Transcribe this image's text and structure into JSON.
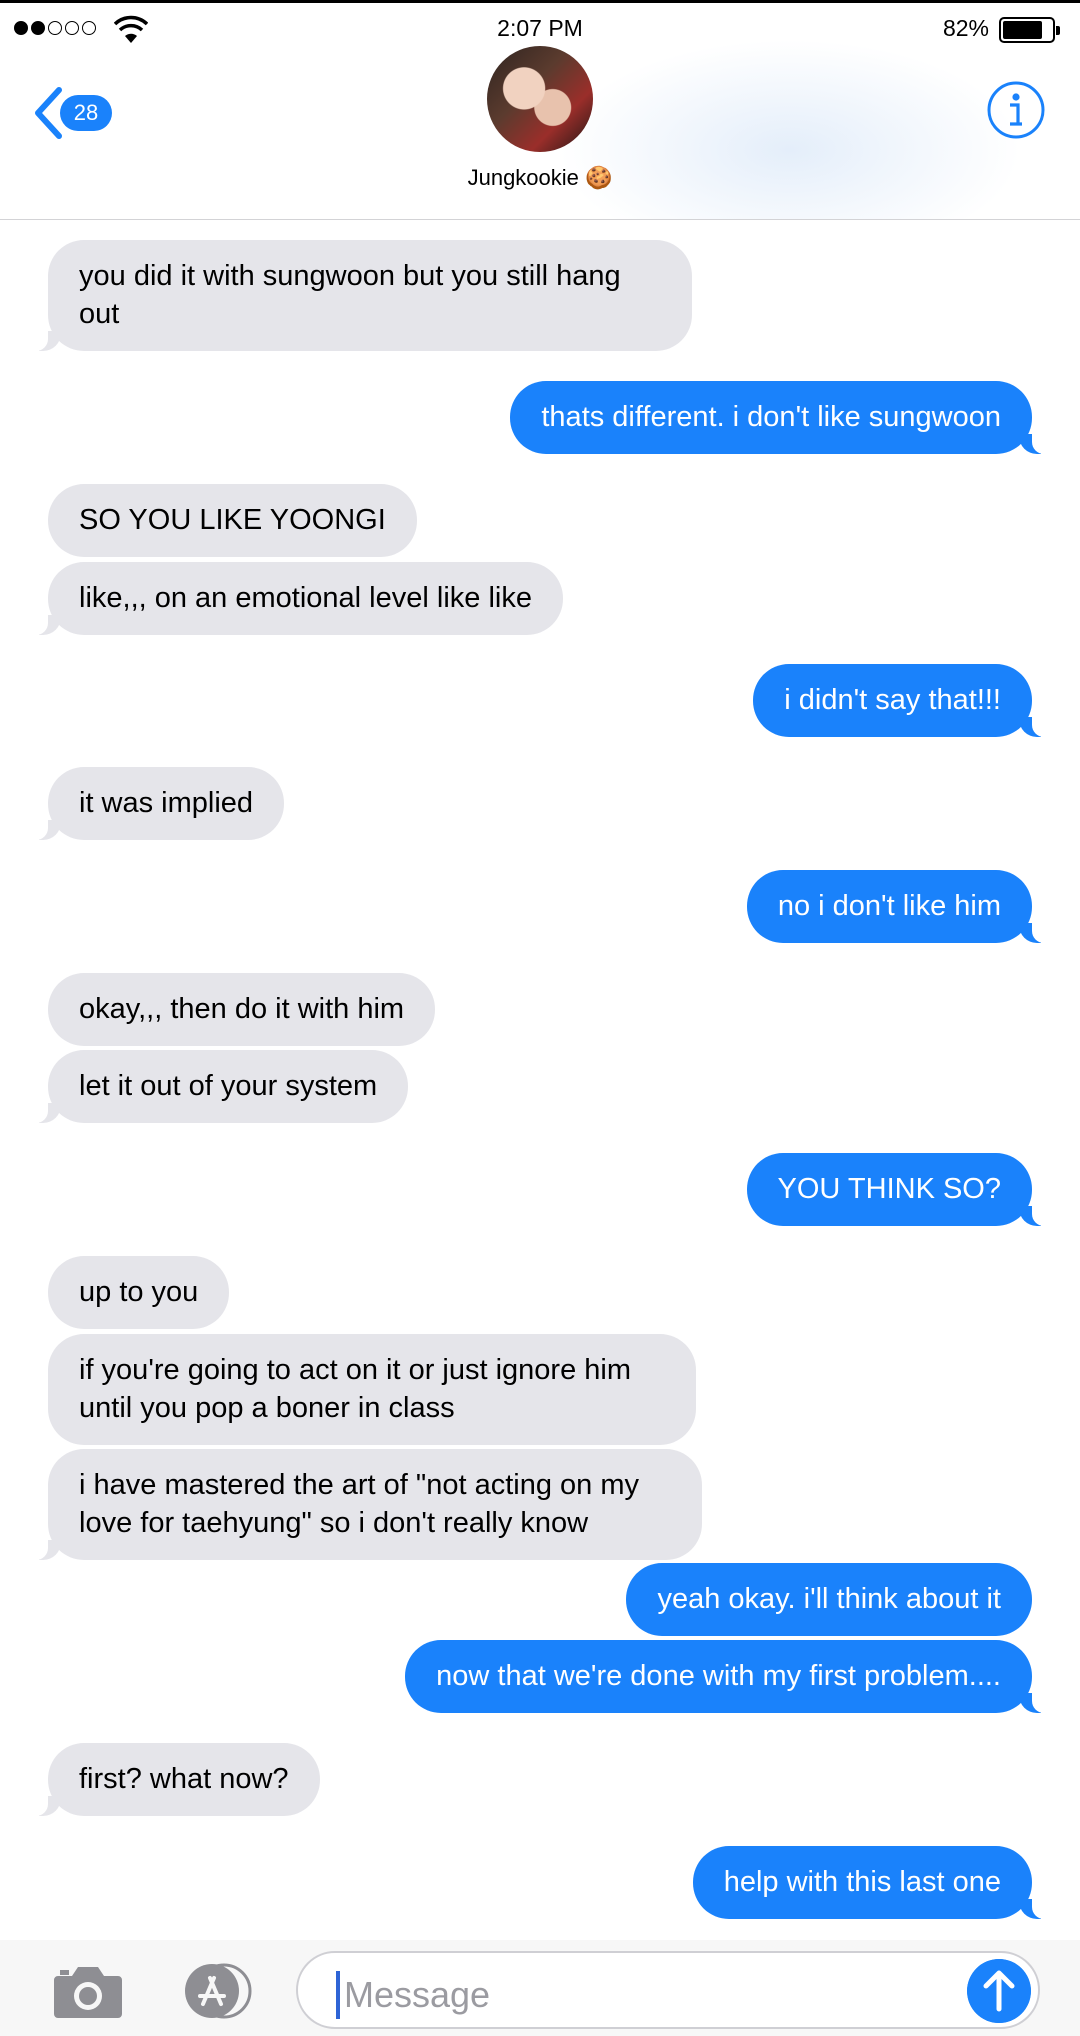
{
  "status_bar": {
    "time": "2:07 PM",
    "battery_percent": "82%",
    "signal_bars_filled": 2,
    "signal_bars_total": 5,
    "battery_level": 0.82
  },
  "header": {
    "back_count": "28",
    "contact_name": "Jungkookie 🍪",
    "back_icon": "chevron-left-icon",
    "info_icon": "info-icon"
  },
  "messages": [
    {
      "from": "them",
      "text": "you did it with sungwoon but you still hang out"
    },
    {
      "from": "me",
      "text": "thats different. i don't like sungwoon"
    },
    {
      "from": "them",
      "text": "SO YOU LIKE YOONGI"
    },
    {
      "from": "them",
      "text": "like,,, on an emotional level like like"
    },
    {
      "from": "me",
      "text": "i didn't say that!!!"
    },
    {
      "from": "them",
      "text": "it was implied"
    },
    {
      "from": "me",
      "text": "no i don't like him"
    },
    {
      "from": "them",
      "text": "okay,,, then do it with him"
    },
    {
      "from": "them",
      "text": "let it out of your system"
    },
    {
      "from": "me",
      "text": "YOU THINK SO?"
    },
    {
      "from": "them",
      "text": "up to you"
    },
    {
      "from": "them",
      "text": "if you're going to act on it or just ignore him until you pop a boner in class"
    },
    {
      "from": "them",
      "text": "i have mastered the art of \"not acting on my love for taehyung\" so i don't really know"
    },
    {
      "from": "me",
      "text": "yeah okay. i'll think about it"
    },
    {
      "from": "me",
      "text": "now that we're done with my first problem...."
    },
    {
      "from": "them",
      "text": "first? what now?"
    },
    {
      "from": "me",
      "text": "help with this last one"
    }
  ],
  "input": {
    "placeholder": "Message",
    "camera_icon": "camera-icon",
    "apps_icon": "app-store-icon",
    "send_icon": "send-arrow-icon"
  },
  "colors": {
    "accent": "#1a82fb",
    "incoming_bubble": "#e5e5ea",
    "outgoing_text": "#ffffff"
  }
}
